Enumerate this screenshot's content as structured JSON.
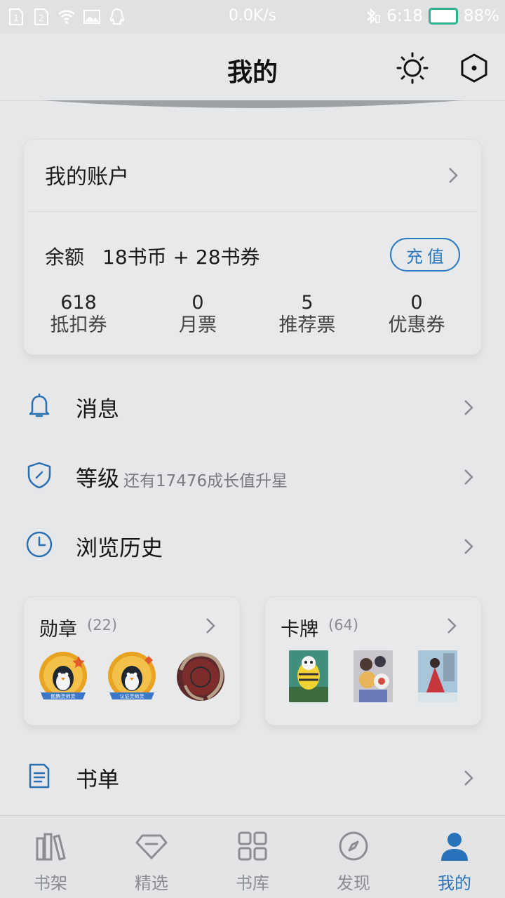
{
  "status_bar": {
    "sim1": "1",
    "sim2": "2",
    "network_speed": "0.0K/s",
    "time": "6:18",
    "battery_percent": "88%",
    "battery_level": 0.88,
    "icons": [
      "sim1-icon",
      "sim2-icon",
      "wifi-icon",
      "image-icon",
      "qq-icon",
      "bluetooth-icon",
      "battery-icon"
    ]
  },
  "header": {
    "title": "我的",
    "theme_icon": "sun-icon",
    "settings_icon": "hexagon-settings-icon"
  },
  "account": {
    "title": "我的账户",
    "balance_label": "余额",
    "balance_value": "18书币 + 28书券",
    "recharge_label": "充值",
    "stats": [
      {
        "value": "618",
        "label": "抵扣券"
      },
      {
        "value": "0",
        "label": "月票"
      },
      {
        "value": "5",
        "label": "推荐票"
      },
      {
        "value": "0",
        "label": "优惠券"
      }
    ]
  },
  "menu": {
    "messages": {
      "label": "消息",
      "icon": "bell-icon"
    },
    "level": {
      "label": "等级",
      "sub": "还有17476成长值升星",
      "icon": "shield-icon"
    },
    "history": {
      "label": "浏览历史",
      "icon": "clock-icon"
    },
    "booklist": {
      "label": "书单",
      "icon": "document-icon"
    }
  },
  "medals": {
    "title": "勋章",
    "count": "(22)",
    "items": [
      "penguin-medal-icon",
      "penguin-medal-icon",
      "dragon-seal-icon"
    ],
    "captions": [
      "鹅腾灵师灵",
      "认证灵师灵"
    ]
  },
  "cards": {
    "title": "卡牌",
    "count": "(64)",
    "items": [
      "penguin-card-thumb",
      "anime-group-card-thumb",
      "red-dress-card-thumb"
    ]
  },
  "bottom_nav": {
    "items": [
      {
        "label": "书架",
        "icon": "bookshelf-icon",
        "active": false
      },
      {
        "label": "精选",
        "icon": "diamond-icon",
        "active": false
      },
      {
        "label": "书库",
        "icon": "grid-icon",
        "active": false
      },
      {
        "label": "发现",
        "icon": "compass-icon",
        "active": false
      },
      {
        "label": "我的",
        "icon": "person-icon",
        "active": true
      }
    ]
  },
  "colors": {
    "accent": "#2872ba",
    "background": "#e6e7e9",
    "battery_border": "#2fb18f"
  }
}
